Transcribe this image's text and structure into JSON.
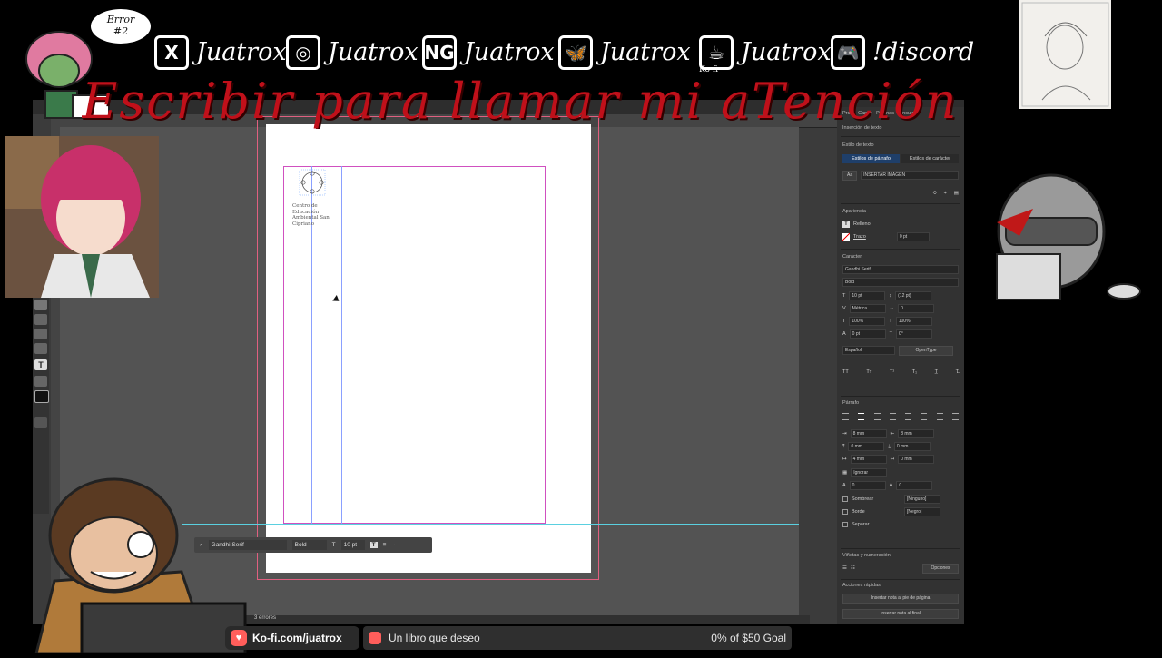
{
  "overlay": {
    "error_bubble": "Error\n#2",
    "socials": [
      {
        "icon": "x-icon",
        "glyph": "X",
        "handle": "Juatrox"
      },
      {
        "icon": "instagram-icon",
        "glyph": "◎",
        "handle": "Juatrox"
      },
      {
        "icon": "newgrounds-icon",
        "glyph": "NG",
        "handle": "Juatrox"
      },
      {
        "icon": "bluesky-icon",
        "glyph": "🦋",
        "handle": "Juatrox"
      },
      {
        "icon": "kofi-icon",
        "glyph": "☕",
        "handle": "Juatrox",
        "sub": "Ko-fi"
      },
      {
        "icon": "discord-controller-icon",
        "glyph": "🎮",
        "handle": "!discord"
      }
    ],
    "banner": "Escribir para llamar mi aTención"
  },
  "document": {
    "logo_text": "Centro de Educación Ambiental San Cipriano",
    "status": "3 errores"
  },
  "context_bar": {
    "font": "Gandhi Serif",
    "style": "Bold",
    "size": "10 pt"
  },
  "panel": {
    "tabs": [
      "Pro...",
      "Capas",
      "Páginas",
      "Vínculos"
    ],
    "section_title": "Inserción de texto",
    "text_style_title": "Estilo de texto",
    "style_tabs": [
      "Estilos de párrafo",
      "Estilos de carácter"
    ],
    "paragraph_style": "INSERTAR IMAGEN",
    "appearance_title": "Apariencia",
    "fill_label": "Relleno",
    "stroke_label": "Trazo",
    "stroke_value": "0 pt",
    "character_title": "Carácter",
    "font": "Gandhi Serif",
    "font_style": "Bold",
    "size": "10 pt",
    "leading": "(12 pt)",
    "kerning": "Métrica",
    "tracking": "0",
    "v_scale": "100%",
    "h_scale": "100%",
    "baseline": "0 pt",
    "skew": "0°",
    "language": "Español",
    "opentype_button": "OpenType",
    "paragraph_title": "Párrafo",
    "indent_left": "8 mm",
    "indent_right": "8 mm",
    "space_before": "0 mm",
    "space_after": "0 mm",
    "first_line": "4 mm",
    "last_line": "0 mm",
    "grid_align": "Ignorar",
    "drop_lines": "0",
    "drop_chars": "0",
    "shading_label": "Sombrear",
    "border_label": "Borde",
    "separator_label": "Separar",
    "shading_swatch": "[Ninguno]",
    "border_swatch": "[Negro]",
    "bullets_title": "Viñetas y numeración",
    "options_button": "Opciones",
    "quick_actions_title": "Acciones rápidas",
    "quick_action_1": "Insertar nota al pie de página",
    "quick_action_2": "Insertar nota al final"
  },
  "kofi": {
    "url": "Ko-fi.com/juatrox",
    "goal_title": "Un libro que deseo",
    "goal_progress": 0,
    "goal_text": "0% of $50 Goal"
  },
  "colors": {
    "banner": "#c0101a",
    "kofi_accent": "#ff5e5b",
    "margin_guide": "#d050c0",
    "bleed_guide": "#e06080",
    "column_guide": "#8aa0ff"
  }
}
